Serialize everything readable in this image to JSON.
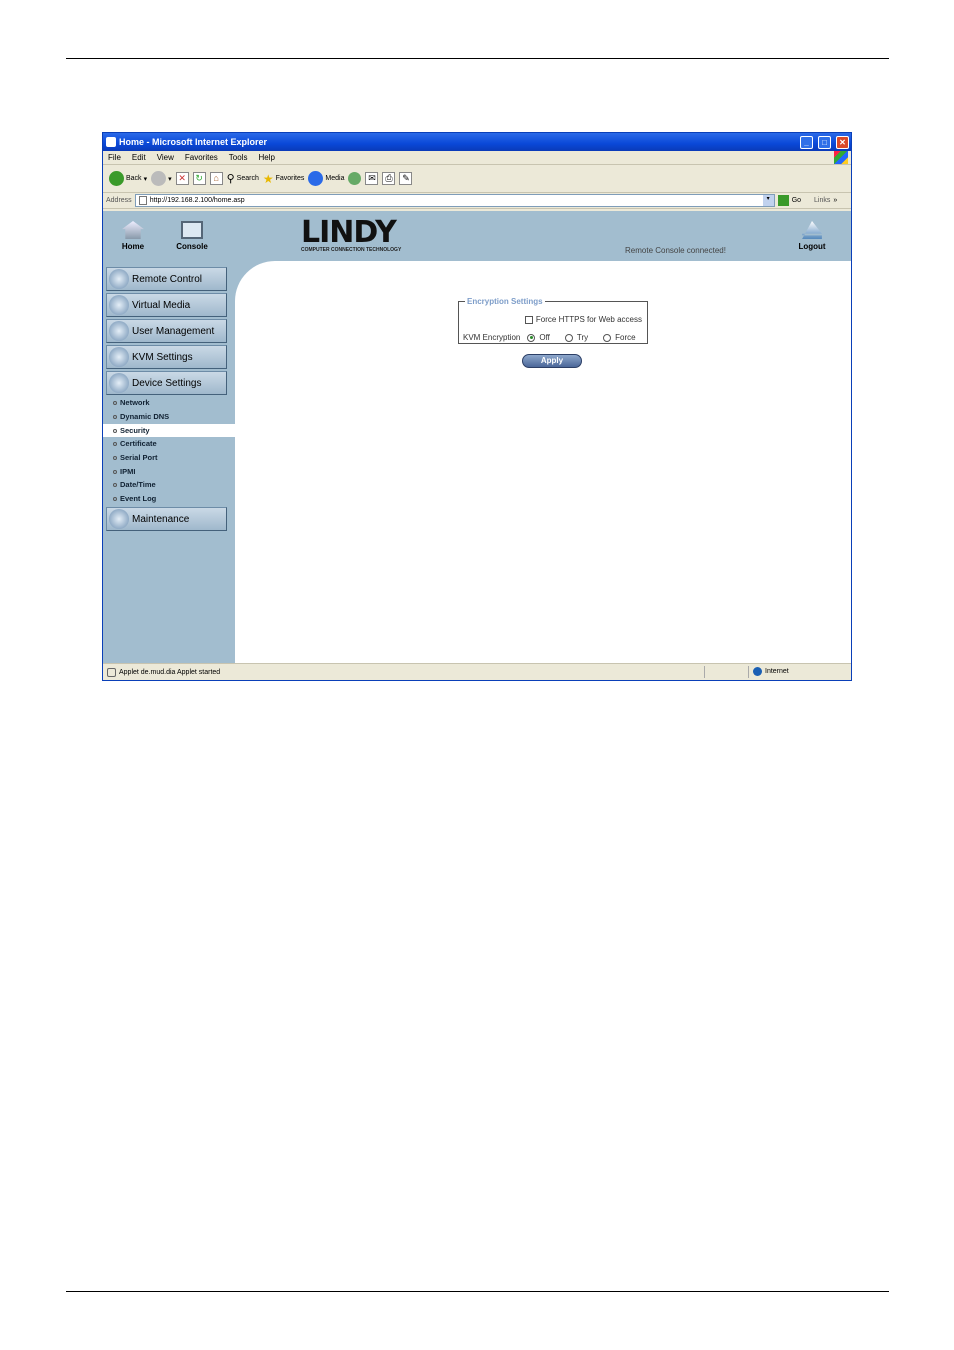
{
  "browser": {
    "title": "Home - Microsoft Internet Explorer",
    "menu": [
      "File",
      "Edit",
      "View",
      "Favorites",
      "Tools",
      "Help"
    ],
    "toolbar": {
      "back": "Back",
      "search": "Search",
      "favorites": "Favorites",
      "media": "Media"
    },
    "address_label": "Address",
    "address_value": "http://192.168.2.100/home.asp",
    "go": "Go",
    "links": "Links",
    "status_text": "Applet de.mud.dia Applet started",
    "zone": "Internet"
  },
  "header": {
    "home": "Home",
    "console": "Console",
    "logout": "Logout",
    "logo_text": "LINDY",
    "logo_tag": "COMPUTER CONNECTION TECHNOLOGY",
    "status": "Remote Console connected!"
  },
  "nav": {
    "buttons": [
      "Remote Control",
      "Virtual Media",
      "User Management",
      "KVM Settings",
      "Device Settings"
    ],
    "sub": [
      "Network",
      "Dynamic DNS",
      "Security",
      "Certificate",
      "Serial Port",
      "IPMI",
      "Date/Time",
      "Event Log"
    ],
    "selected": "Security",
    "maintenance": "Maintenance"
  },
  "form": {
    "legend": "Encryption Settings",
    "force_https_label": "Force HTTPS for Web access",
    "force_https_checked": false,
    "kvm_label": "KVM Encryption",
    "options": [
      "Off",
      "Try",
      "Force"
    ],
    "selected_option": "Off",
    "apply": "Apply"
  }
}
